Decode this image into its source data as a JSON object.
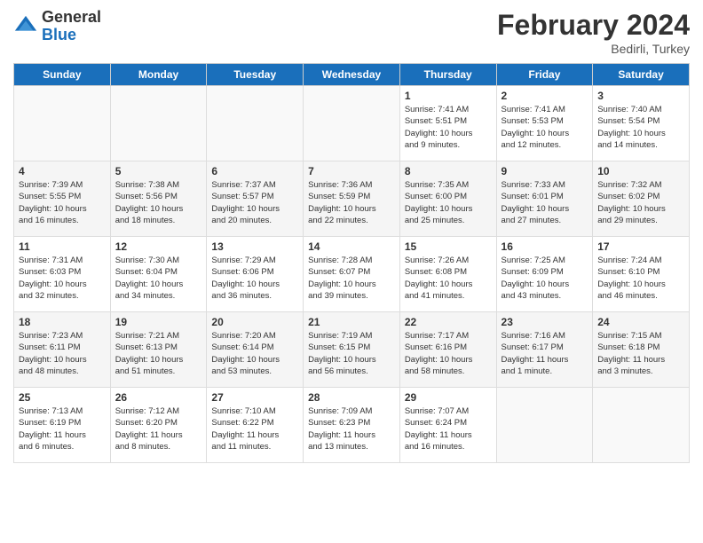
{
  "header": {
    "logo_general": "General",
    "logo_blue": "Blue",
    "title": "February 2024",
    "location": "Bedirli, Turkey"
  },
  "weekdays": [
    "Sunday",
    "Monday",
    "Tuesday",
    "Wednesday",
    "Thursday",
    "Friday",
    "Saturday"
  ],
  "weeks": [
    [
      {
        "day": "",
        "info": ""
      },
      {
        "day": "",
        "info": ""
      },
      {
        "day": "",
        "info": ""
      },
      {
        "day": "",
        "info": ""
      },
      {
        "day": "1",
        "info": "Sunrise: 7:41 AM\nSunset: 5:51 PM\nDaylight: 10 hours\nand 9 minutes."
      },
      {
        "day": "2",
        "info": "Sunrise: 7:41 AM\nSunset: 5:53 PM\nDaylight: 10 hours\nand 12 minutes."
      },
      {
        "day": "3",
        "info": "Sunrise: 7:40 AM\nSunset: 5:54 PM\nDaylight: 10 hours\nand 14 minutes."
      }
    ],
    [
      {
        "day": "4",
        "info": "Sunrise: 7:39 AM\nSunset: 5:55 PM\nDaylight: 10 hours\nand 16 minutes."
      },
      {
        "day": "5",
        "info": "Sunrise: 7:38 AM\nSunset: 5:56 PM\nDaylight: 10 hours\nand 18 minutes."
      },
      {
        "day": "6",
        "info": "Sunrise: 7:37 AM\nSunset: 5:57 PM\nDaylight: 10 hours\nand 20 minutes."
      },
      {
        "day": "7",
        "info": "Sunrise: 7:36 AM\nSunset: 5:59 PM\nDaylight: 10 hours\nand 22 minutes."
      },
      {
        "day": "8",
        "info": "Sunrise: 7:35 AM\nSunset: 6:00 PM\nDaylight: 10 hours\nand 25 minutes."
      },
      {
        "day": "9",
        "info": "Sunrise: 7:33 AM\nSunset: 6:01 PM\nDaylight: 10 hours\nand 27 minutes."
      },
      {
        "day": "10",
        "info": "Sunrise: 7:32 AM\nSunset: 6:02 PM\nDaylight: 10 hours\nand 29 minutes."
      }
    ],
    [
      {
        "day": "11",
        "info": "Sunrise: 7:31 AM\nSunset: 6:03 PM\nDaylight: 10 hours\nand 32 minutes."
      },
      {
        "day": "12",
        "info": "Sunrise: 7:30 AM\nSunset: 6:04 PM\nDaylight: 10 hours\nand 34 minutes."
      },
      {
        "day": "13",
        "info": "Sunrise: 7:29 AM\nSunset: 6:06 PM\nDaylight: 10 hours\nand 36 minutes."
      },
      {
        "day": "14",
        "info": "Sunrise: 7:28 AM\nSunset: 6:07 PM\nDaylight: 10 hours\nand 39 minutes."
      },
      {
        "day": "15",
        "info": "Sunrise: 7:26 AM\nSunset: 6:08 PM\nDaylight: 10 hours\nand 41 minutes."
      },
      {
        "day": "16",
        "info": "Sunrise: 7:25 AM\nSunset: 6:09 PM\nDaylight: 10 hours\nand 43 minutes."
      },
      {
        "day": "17",
        "info": "Sunrise: 7:24 AM\nSunset: 6:10 PM\nDaylight: 10 hours\nand 46 minutes."
      }
    ],
    [
      {
        "day": "18",
        "info": "Sunrise: 7:23 AM\nSunset: 6:11 PM\nDaylight: 10 hours\nand 48 minutes."
      },
      {
        "day": "19",
        "info": "Sunrise: 7:21 AM\nSunset: 6:13 PM\nDaylight: 10 hours\nand 51 minutes."
      },
      {
        "day": "20",
        "info": "Sunrise: 7:20 AM\nSunset: 6:14 PM\nDaylight: 10 hours\nand 53 minutes."
      },
      {
        "day": "21",
        "info": "Sunrise: 7:19 AM\nSunset: 6:15 PM\nDaylight: 10 hours\nand 56 minutes."
      },
      {
        "day": "22",
        "info": "Sunrise: 7:17 AM\nSunset: 6:16 PM\nDaylight: 10 hours\nand 58 minutes."
      },
      {
        "day": "23",
        "info": "Sunrise: 7:16 AM\nSunset: 6:17 PM\nDaylight: 11 hours\nand 1 minute."
      },
      {
        "day": "24",
        "info": "Sunrise: 7:15 AM\nSunset: 6:18 PM\nDaylight: 11 hours\nand 3 minutes."
      }
    ],
    [
      {
        "day": "25",
        "info": "Sunrise: 7:13 AM\nSunset: 6:19 PM\nDaylight: 11 hours\nand 6 minutes."
      },
      {
        "day": "26",
        "info": "Sunrise: 7:12 AM\nSunset: 6:20 PM\nDaylight: 11 hours\nand 8 minutes."
      },
      {
        "day": "27",
        "info": "Sunrise: 7:10 AM\nSunset: 6:22 PM\nDaylight: 11 hours\nand 11 minutes."
      },
      {
        "day": "28",
        "info": "Sunrise: 7:09 AM\nSunset: 6:23 PM\nDaylight: 11 hours\nand 13 minutes."
      },
      {
        "day": "29",
        "info": "Sunrise: 7:07 AM\nSunset: 6:24 PM\nDaylight: 11 hours\nand 16 minutes."
      },
      {
        "day": "",
        "info": ""
      },
      {
        "day": "",
        "info": ""
      }
    ]
  ]
}
